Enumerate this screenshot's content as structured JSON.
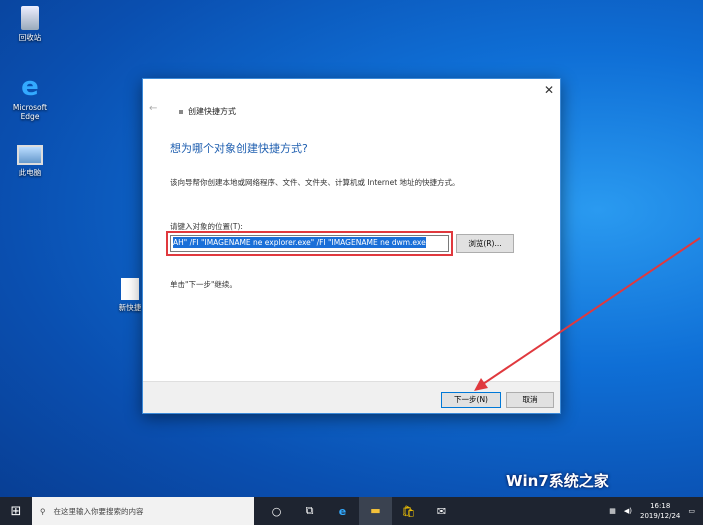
{
  "desktop": {
    "icons": [
      {
        "label": "回收站"
      },
      {
        "label": "Microsoft Edge"
      },
      {
        "label": "此电脑"
      },
      {
        "label": "新快捷"
      }
    ]
  },
  "dialog": {
    "close": "✕",
    "back": "←",
    "title": "创建快捷方式",
    "heading": "想为哪个对象创建快捷方式?",
    "description": "该向导帮你创建本地或网络程序、文件、文件夹、计算机或 Internet 地址的快捷方式。",
    "location_label": "请键入对象的位置(T):",
    "location_value": "AH\" /FI \"IMAGENAME ne explorer.exe\" /FI \"IMAGENAME ne dwm.exe",
    "browse": "浏览(R)...",
    "hint": "单击\"下一步\"继续。",
    "next": "下一步(N)",
    "cancel": "取消"
  },
  "taskbar": {
    "search_placeholder": "在这里输入你要搜索的内容",
    "time": "16:18",
    "date": "2019/12/24"
  },
  "watermark": "Win7系统之家",
  "colors": {
    "accent": "#0078d7",
    "highlight": "#e0393e"
  }
}
